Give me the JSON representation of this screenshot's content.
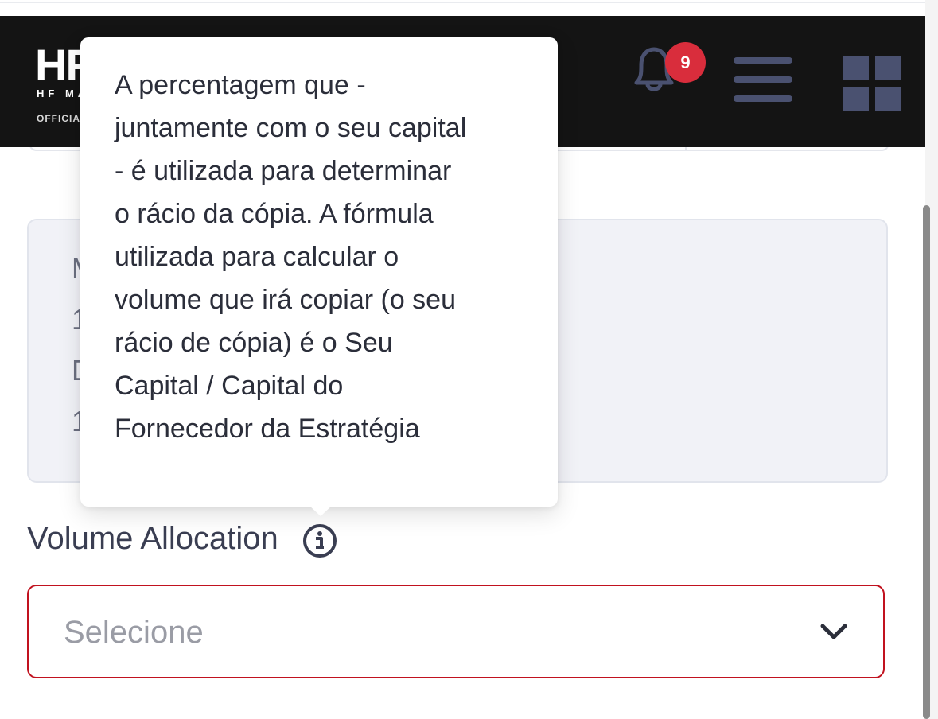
{
  "header": {
    "logo_mark": "HF",
    "logo_sub": "HF MARKETS",
    "logo_tag": "OFFICIAL",
    "notification_count": "9",
    "icons": [
      "bell-icon",
      "menu-icon",
      "grid-icon"
    ]
  },
  "card": {
    "lines": [
      "M",
      "1",
      "D",
      "1"
    ]
  },
  "tooltip": {
    "lines": [
      "A percentagem que -",
      "juntamente com o seu capital",
      "- é utilizada para determinar",
      "o rácio da cópia. A fórmula",
      "utilizada para calcular o",
      "volume que irá copiar (o seu",
      "rácio de cópia) é o Seu",
      "Capital / Capital do",
      "Fornecedor da Estratégia"
    ]
  },
  "field": {
    "label": "Volume Allocation",
    "select_value": "Selecione"
  },
  "colors": {
    "header_bg": "#141414",
    "badge": "#d92d3c",
    "error_border": "#c1121f",
    "icon": "#4a5170"
  }
}
